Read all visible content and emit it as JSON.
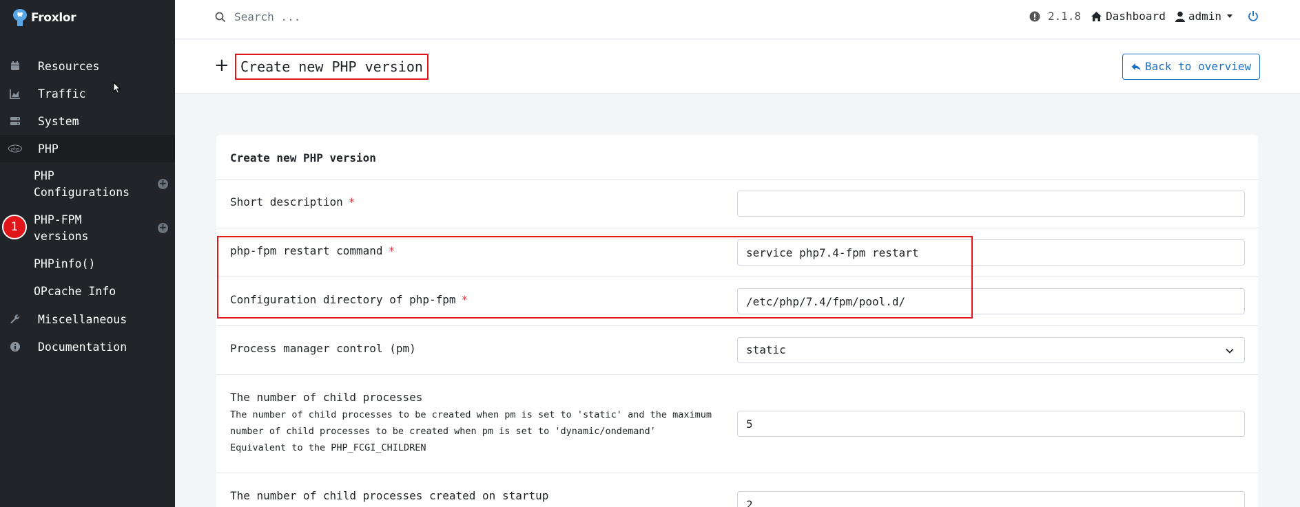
{
  "sidebar": {
    "brand": "Froxlor",
    "items": [
      {
        "label": "Resources"
      },
      {
        "label": "Traffic"
      },
      {
        "label": "System"
      },
      {
        "label": "PHP"
      },
      {
        "label": "Miscellaneous"
      },
      {
        "label": "Documentation"
      }
    ],
    "sub_items": [
      {
        "label": "PHP\nConfigurations"
      },
      {
        "label": "PHP-FPM\nversions"
      },
      {
        "label": "PHPinfo()"
      },
      {
        "label": "OPcache Info"
      }
    ],
    "annotation_badge": "1"
  },
  "topbar": {
    "search_placeholder": "Search ...",
    "version": "2.1.8",
    "dashboard": "Dashboard",
    "user": "admin"
  },
  "header": {
    "title": "Create new PHP version",
    "back_button": "Back to overview"
  },
  "form": {
    "card_title": "Create new PHP version",
    "fields": [
      {
        "label": "Short description",
        "required": "*",
        "value": ""
      },
      {
        "label": "php-fpm restart command",
        "required": "*",
        "value": "service php7.4-fpm restart"
      },
      {
        "label": "Configuration directory of php-fpm",
        "required": "*",
        "value": "/etc/php/7.4/fpm/pool.d/"
      },
      {
        "label": "Process manager control (pm)",
        "value": "static"
      },
      {
        "label": "The number of child processes",
        "description": [
          "The number of child processes to be created when pm is set to 'static' and the maximum",
          "number of child processes to be created when pm is set to 'dynamic/ondemand'",
          "Equivalent to the PHP_FCGI_CHILDREN"
        ],
        "value": "5"
      },
      {
        "label": "The number of child processes created on startup",
        "value": "2"
      }
    ]
  },
  "colors": {
    "sidebar_bg": "#212529",
    "highlight_red": "#e0161a",
    "link_blue": "#1a6fc4",
    "required_red": "#dc3545"
  }
}
